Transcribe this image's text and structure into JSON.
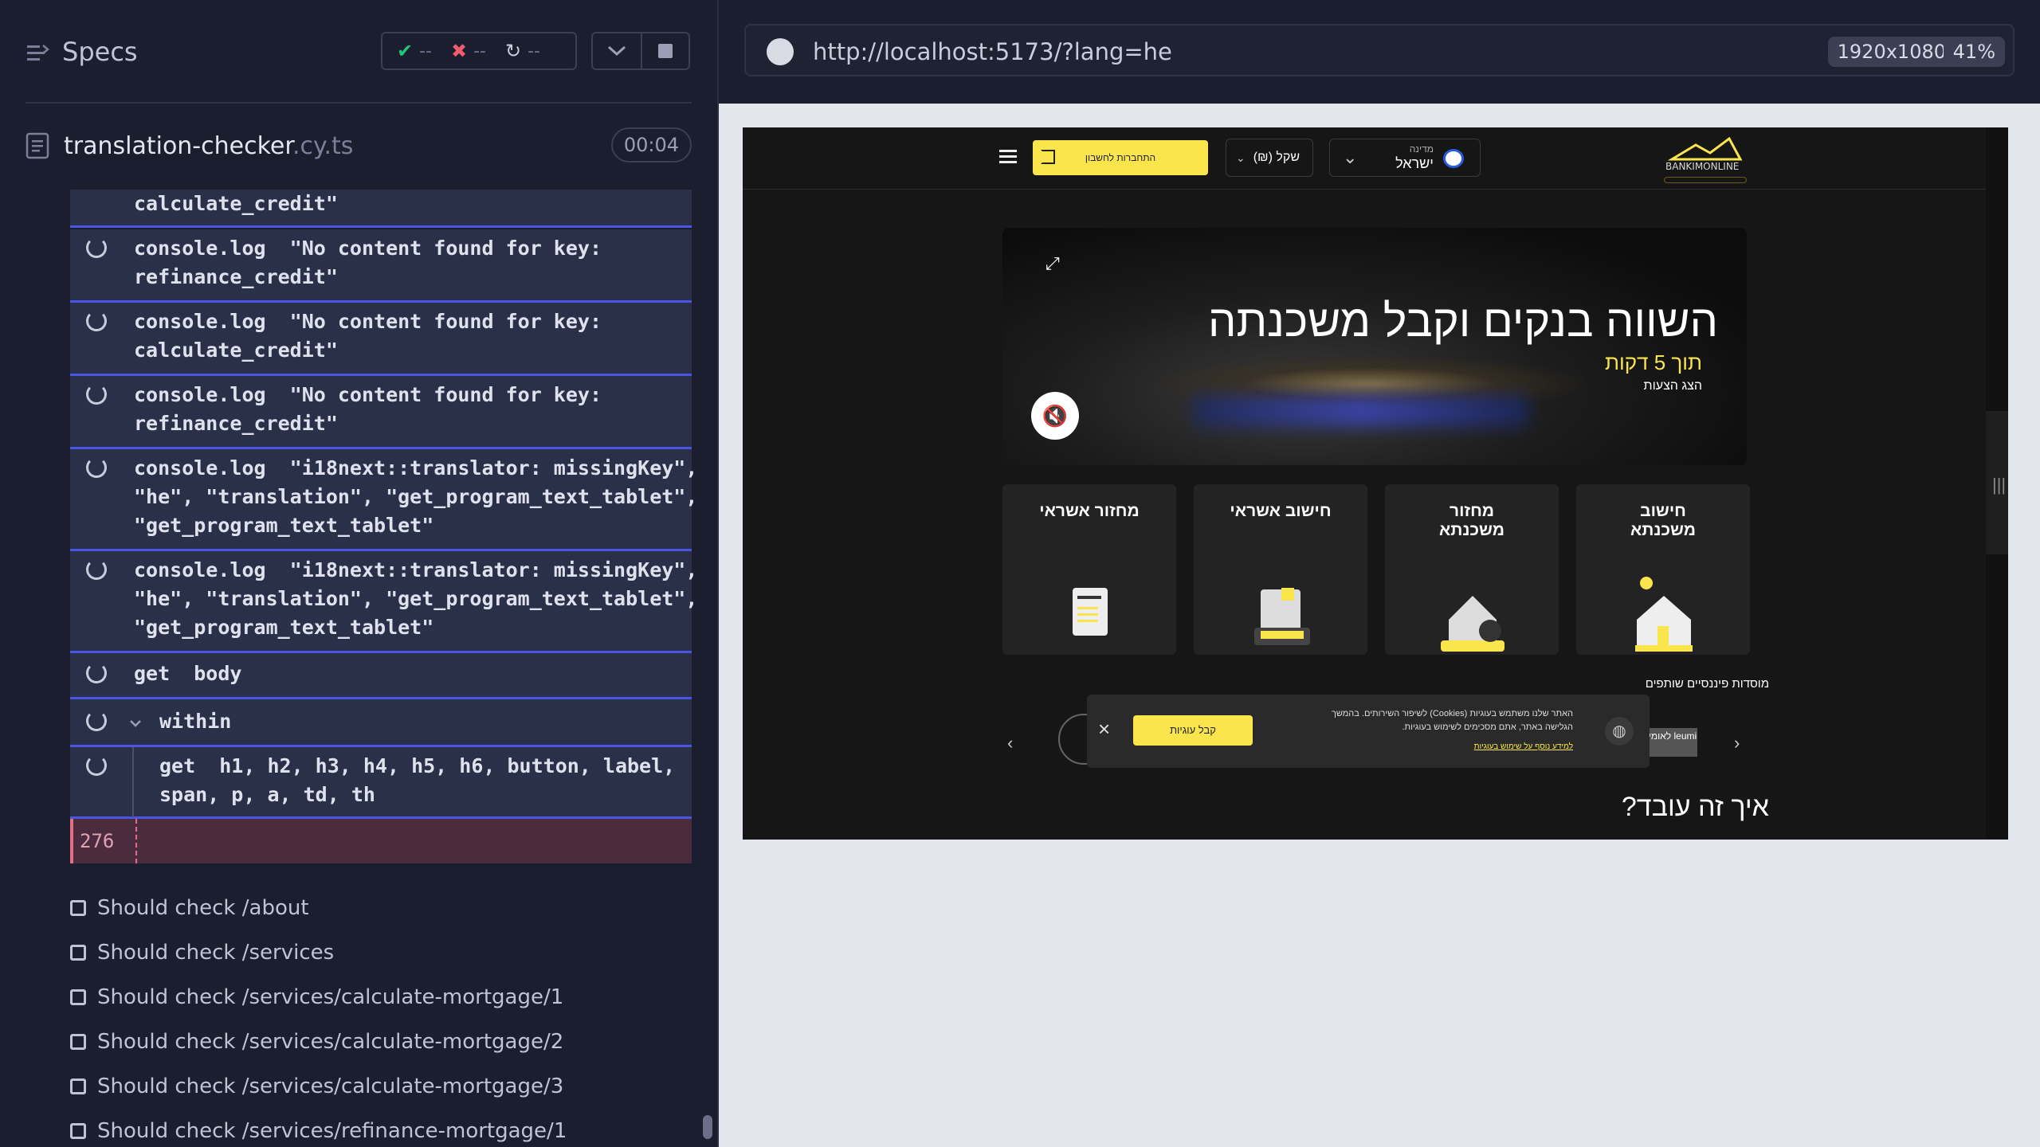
{
  "runner": {
    "title": "Specs",
    "stats": {
      "passed": "--",
      "failed": "--",
      "pending": "--"
    },
    "file": {
      "name": "translation-checker",
      "ext": ".cy.ts",
      "duration": "00:04"
    },
    "logs": [
      {
        "text": "calculate_credit\""
      },
      {
        "text": "console.log  \"No content found for key:\nrefinance_credit\""
      },
      {
        "text": "console.log  \"No content found for key:\ncalculate_credit\""
      },
      {
        "text": "console.log  \"No content found for key:\nrefinance_credit\""
      },
      {
        "text": "console.log  \"i18next::translator: missingKey\",\n\"he\", \"translation\", \"get_program_text_tablet\",\n\"get_program_text_tablet\""
      },
      {
        "text": "console.log  \"i18next::translator: missingKey\",\n\"he\", \"translation\", \"get_program_text_tablet\",\n\"get_program_text_tablet\""
      },
      {
        "text": "get  body"
      },
      {
        "text": "within"
      },
      {
        "text": "get  h1, h2, h3, h4, h5, h6, button, label,\nspan, p, a, td, th"
      }
    ],
    "line_number": "276",
    "tests": [
      "Should check /about",
      "Should check /services",
      "Should check /services/calculate-mortgage/1",
      "Should check /services/calculate-mortgage/2",
      "Should check /services/calculate-mortgage/3",
      "Should check /services/refinance-mortgage/1"
    ]
  },
  "browser": {
    "url": "http://localhost:5173/?lang=he",
    "viewport": "1920x1080",
    "zoom": "41%"
  },
  "app": {
    "logo": "BANKIMONLINE",
    "country_label": "מדינה",
    "country": "ישראל",
    "currency": "(₪) שקל",
    "login": "התחברות לחשבון",
    "hero_title": "השווה בנקים וקבל משכנתה",
    "hero_yellow": "תוך 5 דקות",
    "hero_sub": "הצג הצעות",
    "cards": [
      {
        "label": "מחזור אשראי"
      },
      {
        "label": "חישוב אשראי"
      },
      {
        "label": "מחזור משכנתא"
      },
      {
        "label": "חישוב משכנתא"
      }
    ],
    "partners": "מוסדות פיננסיים שותפים",
    "leumi": "לאומי leumi",
    "cookie_text": "האתר שלנו משתמש בעוגיות (Cookies) לשיפור השירותים. בהמשך הגלישה באתר, אתם מסכימים לשימוש בעוגיות.",
    "cookie_link": "למידע נוסף על שימוש בעוגיות",
    "cookie_accept": "קבל עוגיות",
    "how": "איך זה עובד?"
  },
  "colors": {
    "accent": "#fbe54d",
    "runner_bg": "#1b1e2e",
    "log_bg": "#2b3049",
    "log_border": "#4956e3"
  }
}
